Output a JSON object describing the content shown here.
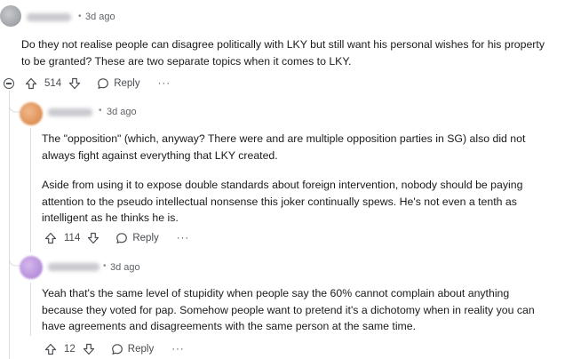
{
  "comments": [
    {
      "username": "",
      "separator": "•",
      "time": "3d ago",
      "paragraphs": [
        "Do they not realise people can disagree politically with LKY but still want his personal wishes for his property",
        "to be granted? These are two separate topics when it comes to LKY."
      ],
      "votes": "514",
      "reply_label": "Reply",
      "more_label": "···",
      "avatar_color": "#b0b3b8"
    },
    {
      "username": "",
      "separator": "•",
      "time": "3d ago",
      "paragraphs": [
        "The \"opposition\" (which, anyway? There were and are multiple opposition parties in SG) also did not",
        "always fight against everything that LKY created.",
        "Aside from using it to expose double standards about foreign intervention, nobody should be paying",
        "attention to the pseudo intellectual nonsense this joker continually spews. He's not even a tenth as",
        "intelligent as he thinks he is."
      ],
      "votes": "114",
      "reply_label": "Reply",
      "more_label": "···",
      "avatar_color": "#e39a5c"
    },
    {
      "username": "",
      "separator": "•",
      "time": "3d ago",
      "paragraphs": [
        "Yeah that's the same level of stupidity when people say the 60% cannot complain about anything",
        "because they voted for pap. Somehow people want to pretend it's a dichotomy when in reality you can",
        "have agreements and disagreements with the same person at the same time."
      ],
      "votes": "12",
      "reply_label": "Reply",
      "more_label": "···",
      "avatar_color": "#b58fd6"
    }
  ],
  "colors": {
    "text": "#1a1a1b",
    "meta": "#5f6368",
    "thread_line": "#dcdde0"
  }
}
